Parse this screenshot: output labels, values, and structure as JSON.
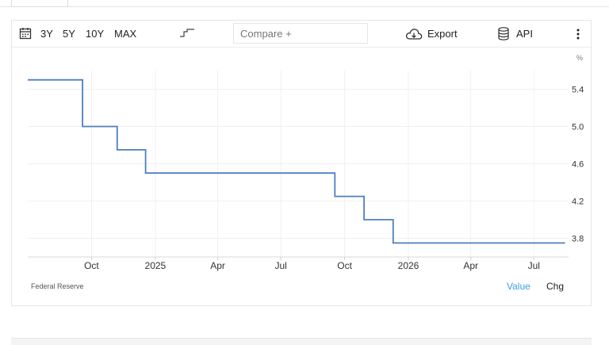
{
  "toolbar": {
    "ranges": [
      "3Y",
      "5Y",
      "10Y",
      "MAX"
    ],
    "compare_placeholder": "Compare +",
    "export_label": "Export",
    "api_label": "API",
    "icons": {
      "calendar": "calendar-icon",
      "step": "step-chart-icon",
      "cloud": "cloud-download-icon",
      "database": "database-icon",
      "menu": "more-vertical-icon"
    }
  },
  "footer": {
    "source": "Federal Reserve",
    "value_label": "Value",
    "chg_label": "Chg"
  },
  "colors": {
    "line": "#4f7fbf",
    "active": "#3aa0e8"
  },
  "chart_data": {
    "type": "line",
    "step": true,
    "unit_label": "%",
    "x_tick_labels": [
      "Oct",
      "2025",
      "Apr",
      "Jul",
      "Oct",
      "2026",
      "Apr",
      "Jul"
    ],
    "x_tick_dates": [
      "2024-10-01",
      "2025-01-01",
      "2025-04-01",
      "2025-07-01",
      "2025-10-01",
      "2026-01-01",
      "2026-04-01",
      "2026-07-01"
    ],
    "x_range": [
      "2024-07-01",
      "2026-08-20"
    ],
    "y_tick_labels": [
      "5.4",
      "5.0",
      "4.6",
      "4.2",
      "3.8"
    ],
    "y_ticks": [
      5.4,
      5.0,
      4.6,
      4.2,
      3.8
    ],
    "ylim": [
      3.6,
      5.6
    ],
    "grid": true,
    "series": [
      {
        "x": [
          "2024-07-01",
          "2024-09-18",
          "2024-11-07",
          "2024-12-18",
          "2025-09-17",
          "2025-10-29",
          "2025-12-10",
          "2026-08-15"
        ],
        "values": [
          5.5,
          5.0,
          4.75,
          4.5,
          4.25,
          4.0,
          3.75,
          3.75
        ]
      }
    ]
  }
}
